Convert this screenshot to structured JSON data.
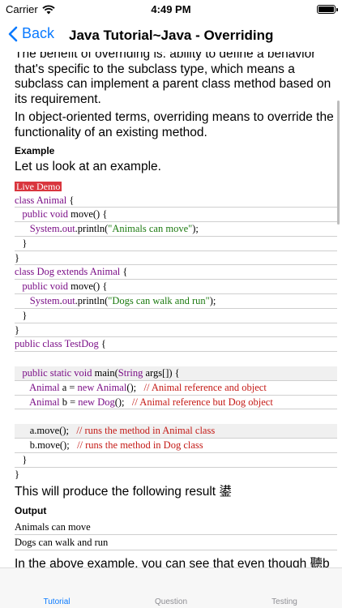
{
  "status": {
    "carrier": "Carrier",
    "time": "4:49 PM"
  },
  "nav": {
    "back_label": "Back",
    "title": "Java Tutorial~Java - Overriding"
  },
  "content": {
    "para1": "The benefit of overriding is: ability to define a behavior that's specific to the subclass type, which means a subclass can implement a parent class method based on its requirement.",
    "para2": "In object-oriented terms, overriding means to override the functionality of an existing method.",
    "example_heading": "Example",
    "example_intro": "Let us look at an example.",
    "live_demo": "Live Demo",
    "code_lines": [
      "class Animal {",
      "   public void move() {",
      "      System.out.println(\"Animals can move\");",
      "   }",
      "}",
      "class Dog extends Animal {",
      "   public void move() {",
      "      System.out.println(\"Dogs can walk and run\");",
      "   }",
      "}",
      "public class TestDog {",
      "",
      "   public static void main(String args[]) {",
      "      Animal a = new Animal();   // Animal reference and object",
      "      Animal b = new Dog();   // Animal reference but Dog object",
      "",
      "      a.move();   // runs the method in Animal class",
      "      b.move();   // runs the method in Dog class",
      "   }",
      "}"
    ],
    "result_text": "This will produce the following result 鍙",
    "output_heading": "Output",
    "output_lines": [
      "Animals can move",
      "Dogs can walk and run"
    ],
    "para3": "In the above example, you can see that even though 聽b聽is a type of Animal it runs the move method in the Dog class. The reason for this is: In compile time, the check is made on the reference type. However, in"
  },
  "tabs": [
    {
      "label": "Tutorial",
      "active": true
    },
    {
      "label": "Question",
      "active": false
    },
    {
      "label": "Testing",
      "active": false
    }
  ],
  "colors": {
    "accent": "#0a7aff",
    "live_demo_bg": "#d9363e",
    "keyword": "#7b0f87",
    "string": "#1c7a10",
    "comment": "#c41a16"
  }
}
